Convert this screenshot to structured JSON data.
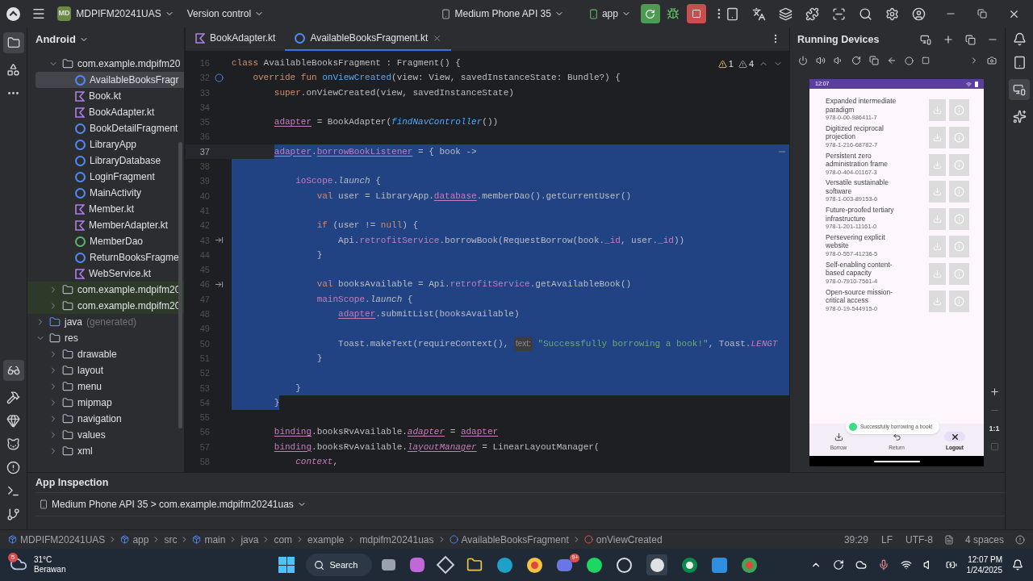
{
  "title_bar": {
    "project_badge": "MD",
    "project": "MDPIFM20241UAS",
    "vcs": "Version control",
    "device": "Medium Phone API 35",
    "run_config": "app"
  },
  "project_panel": {
    "view": "Android",
    "tree": [
      {
        "label": "com.example.mdpifm20",
        "kind": "package",
        "expanded": true,
        "selected": false,
        "children": [
          {
            "label": "AvailableBooksFragr",
            "kind": "class",
            "selected": true
          },
          {
            "label": "Book.kt",
            "kind": "kotlin_file",
            "selected": false
          },
          {
            "label": "BookAdapter.kt",
            "kind": "kotlin_file",
            "selected": false
          },
          {
            "label": "BookDetailFragment",
            "kind": "class",
            "selected": false
          },
          {
            "label": "LibraryApp",
            "kind": "class",
            "selected": false
          },
          {
            "label": "LibraryDatabase",
            "kind": "class",
            "selected": false
          },
          {
            "label": "LoginFragment",
            "kind": "class",
            "selected": false
          },
          {
            "label": "MainActivity",
            "kind": "class",
            "selected": false
          },
          {
            "label": "Member.kt",
            "kind": "kotlin_file",
            "selected": false
          },
          {
            "label": "MemberAdapter.kt",
            "kind": "kotlin_file",
            "selected": false
          },
          {
            "label": "MemberDao",
            "kind": "interface",
            "selected": false
          },
          {
            "label": "ReturnBooksFragme",
            "kind": "class",
            "selected": false
          },
          {
            "label": "WebService.kt",
            "kind": "kotlin_file",
            "selected": false
          }
        ]
      },
      {
        "label": "com.example.mdpifm20",
        "kind": "test_package",
        "expanded": false,
        "selected": false
      },
      {
        "label": "com.example.mdpifm20",
        "kind": "test_package",
        "expanded": false,
        "selected": false
      },
      {
        "label": "java",
        "note": "(generated)",
        "kind": "generated_folder",
        "expanded": false,
        "selected": false
      },
      {
        "label": "res",
        "kind": "res_folder",
        "expanded": true,
        "selected": false,
        "children": [
          {
            "label": "drawable",
            "kind": "folder",
            "expanded": false,
            "selected": false
          },
          {
            "label": "layout",
            "kind": "folder",
            "expanded": false,
            "selected": false
          },
          {
            "label": "menu",
            "kind": "folder",
            "expanded": false,
            "selected": false
          },
          {
            "label": "mipmap",
            "kind": "folder",
            "expanded": false,
            "selected": false
          },
          {
            "label": "navigation",
            "kind": "folder",
            "expanded": false,
            "selected": false
          },
          {
            "label": "values",
            "kind": "folder",
            "expanded": false,
            "selected": false
          },
          {
            "label": "xml",
            "kind": "folder",
            "expanded": false,
            "selected": false
          }
        ]
      }
    ]
  },
  "editor": {
    "tabs": [
      {
        "label": "BookAdapter.kt",
        "kind": "kotlin_file",
        "selected": false
      },
      {
        "label": "AvailableBooksFragment.kt",
        "kind": "class",
        "selected": true
      }
    ],
    "warnings": "1",
    "weak_warnings": "4",
    "lines": [
      {
        "number": "16",
        "current": false,
        "selected": false,
        "tokens": [
          {
            "text": "class",
            "kind": "kw"
          },
          {
            "text": " AvailableBooksFragment : Fragment() {",
            "kind": "plain"
          }
        ]
      },
      {
        "number": "32",
        "current": false,
        "selected": false,
        "gutter": {
          "kind": "override"
        },
        "tokens": [
          {
            "text": "    override fun",
            "kind": "kw"
          },
          {
            "text": " onViewCreated",
            "kind": "decl"
          },
          {
            "text": "(view: View, savedInstanceState: Bundle?) {",
            "kind": "plain"
          }
        ]
      },
      {
        "number": "33",
        "current": false,
        "selected": false,
        "tokens": [
          {
            "text": "        super",
            "kind": "kw"
          },
          {
            "text": ".onViewCreated(view, savedInstanceState)",
            "kind": "plain"
          }
        ]
      },
      {
        "number": "34",
        "current": false,
        "selected": false
      },
      {
        "number": "35",
        "current": false,
        "selected": false,
        "tokens": [
          {
            "text": "        adapter",
            "kind": "var"
          },
          {
            "text": " = BookAdapter(",
            "kind": "plain"
          },
          {
            "text": "findNavController",
            "kind": "ext"
          },
          {
            "text": "())",
            "kind": "plain"
          }
        ]
      },
      {
        "number": "36",
        "current": false,
        "selected": false
      },
      {
        "number": "37",
        "current": true,
        "selected": true,
        "fold": true,
        "tokens": [
          {
            "text": "        adapter",
            "kind": "var"
          },
          {
            "text": ".",
            "kind": "plain"
          },
          {
            "text": "borrowBookListener",
            "kind": "var"
          },
          {
            "text": " = { book ->",
            "kind": "plain"
          }
        ]
      },
      {
        "number": "38",
        "current": false,
        "selected": true
      },
      {
        "number": "39",
        "current": false,
        "selected": true,
        "tokens": [
          {
            "text": "            ioScope",
            "kind": "prop"
          },
          {
            "text": ".",
            "kind": "plain"
          },
          {
            "text": "launch",
            "kind": "italic"
          },
          {
            "text": " {",
            "kind": "plain"
          }
        ]
      },
      {
        "number": "40",
        "current": false,
        "selected": true,
        "tokens": [
          {
            "text": "                val",
            "kind": "kw"
          },
          {
            "text": " user = LibraryApp.",
            "kind": "plain"
          },
          {
            "text": "database",
            "kind": "var"
          },
          {
            "text": ".memberDao().getCurrentUser()",
            "kind": "plain"
          }
        ]
      },
      {
        "number": "41",
        "current": false,
        "selected": true
      },
      {
        "number": "42",
        "current": false,
        "selected": true,
        "tokens": [
          {
            "text": "                if",
            "kind": "kw"
          },
          {
            "text": " (user != ",
            "kind": "plain"
          },
          {
            "text": "null",
            "kind": "kw"
          },
          {
            "text": ") {",
            "kind": "plain"
          }
        ]
      },
      {
        "number": "43",
        "current": false,
        "selected": true,
        "gutter": {
          "kind": "suspend"
        },
        "tokens": [
          {
            "text": "                    Api.",
            "kind": "plain"
          },
          {
            "text": "retrofitService",
            "kind": "prop"
          },
          {
            "text": ".borrowBook(RequestBorrow(book.",
            "kind": "plain"
          },
          {
            "text": "_id",
            "kind": "prop"
          },
          {
            "text": ", user.",
            "kind": "plain"
          },
          {
            "text": "_id",
            "kind": "prop"
          },
          {
            "text": "))",
            "kind": "plain"
          }
        ]
      },
      {
        "number": "44",
        "current": false,
        "selected": true,
        "tokens": [
          {
            "text": "                }",
            "kind": "plain"
          }
        ]
      },
      {
        "number": "45",
        "current": false,
        "selected": true
      },
      {
        "number": "46",
        "current": false,
        "selected": true,
        "gutter": {
          "kind": "suspend"
        },
        "tokens": [
          {
            "text": "                val",
            "kind": "kw"
          },
          {
            "text": " booksAvailable = Api.",
            "kind": "plain"
          },
          {
            "text": "retrofitService",
            "kind": "prop"
          },
          {
            "text": ".getAvailableBook()",
            "kind": "plain"
          }
        ]
      },
      {
        "number": "47",
        "current": false,
        "selected": true,
        "tokens": [
          {
            "text": "                mainScope",
            "kind": "prop"
          },
          {
            "text": ".",
            "kind": "plain"
          },
          {
            "text": "launch",
            "kind": "italic"
          },
          {
            "text": " {",
            "kind": "plain"
          }
        ]
      },
      {
        "number": "48",
        "current": false,
        "selected": true,
        "tokens": [
          {
            "text": "                    adapter",
            "kind": "var"
          },
          {
            "text": ".submitList(booksAvailable)",
            "kind": "plain"
          }
        ]
      },
      {
        "number": "49",
        "current": false,
        "selected": true
      },
      {
        "number": "50",
        "current": false,
        "selected": true,
        "tokens": [
          {
            "text": "                    Toast.makeText(requireContext(), ",
            "kind": "plain"
          },
          {
            "text": "text:",
            "kind": "hint"
          },
          {
            "text": " \"Successfully borrowing a book!\"",
            "kind": "string"
          },
          {
            "text": ", Toast.",
            "kind": "plain"
          },
          {
            "text": "LENGT",
            "kind": "const"
          }
        ]
      },
      {
        "number": "51",
        "current": false,
        "selected": true,
        "tokens": [
          {
            "text": "                }",
            "kind": "plain"
          }
        ]
      },
      {
        "number": "52",
        "current": false,
        "selected": true
      },
      {
        "number": "53",
        "current": false,
        "selected": true,
        "tokens": [
          {
            "text": "            }",
            "kind": "plain"
          }
        ]
      },
      {
        "number": "54",
        "current": false,
        "selected": true,
        "tokens": [
          {
            "text": "        }",
            "kind": "plain"
          }
        ]
      },
      {
        "number": "55",
        "current": false,
        "selected": false
      },
      {
        "number": "56",
        "current": false,
        "selected": false,
        "tokens": [
          {
            "text": "        binding",
            "kind": "var"
          },
          {
            "text": ".booksRvAvailable.",
            "kind": "plain"
          },
          {
            "text": "adapter",
            "kind": "ivar"
          },
          {
            "text": " = ",
            "kind": "plain"
          },
          {
            "text": "adapter",
            "kind": "var"
          }
        ]
      },
      {
        "number": "57",
        "current": false,
        "selected": false,
        "tokens": [
          {
            "text": "        binding",
            "kind": "var"
          },
          {
            "text": ".booksRvAvailable.",
            "kind": "plain"
          },
          {
            "text": "layoutManager",
            "kind": "ivar"
          },
          {
            "text": " = LinearLayoutManager(",
            "kind": "plain"
          }
        ]
      },
      {
        "number": "58",
        "current": false,
        "selected": false,
        "tokens": [
          {
            "text": "            context",
            "kind": "const"
          },
          {
            "text": ",",
            "kind": "plain"
          }
        ]
      }
    ]
  },
  "running_devices": {
    "title": "Running Devices",
    "phone": {
      "time": "12:07",
      "books": [
        {
          "title": "Expanded intermediate paradigm",
          "isbn": "978-0-00-986411-7"
        },
        {
          "title": "Digitized reciprocal projection",
          "isbn": "978-1-216-68782-7"
        },
        {
          "title": "Persistent zero administration frame",
          "isbn": "978-0-404-01167-3"
        },
        {
          "title": "Versatile sustainable software",
          "isbn": "978-1-003-89153-6"
        },
        {
          "title": "Future-proofed tertiary infrastructure",
          "isbn": "978-1-201-11161-0"
        },
        {
          "title": "Persevering explicit website",
          "isbn": "978-0-557-41236-5"
        },
        {
          "title": "Self-enabling content-based capacity",
          "isbn": "978-0-7910-7561-4"
        },
        {
          "title": "Open-source mission-critical access",
          "isbn": "978-0-19-544915-0"
        }
      ],
      "nav": [
        {
          "label": "Borrow",
          "kind": "borrow",
          "selected": false
        },
        {
          "label": "Return",
          "kind": "return",
          "selected": false
        },
        {
          "label": "Logout",
          "kind": "logout",
          "selected": true
        }
      ],
      "toast": "Successfully borrowing a book!"
    },
    "zoom_label": "1:1"
  },
  "app_inspection": {
    "title": "App Inspection",
    "target": "Medium Phone API 35 > com.example.mdpifm20241uas"
  },
  "status_bar": {
    "breadcrumbs": [
      {
        "label": "MDPIFM20241UAS",
        "kind": "module"
      },
      {
        "label": "app",
        "kind": "module"
      },
      {
        "label": "src",
        "kind": "plain"
      },
      {
        "label": "main",
        "kind": "module"
      },
      {
        "label": "java",
        "kind": "plain"
      },
      {
        "label": "com",
        "kind": "plain"
      },
      {
        "label": "example",
        "kind": "plain"
      },
      {
        "label": "mdpifm20241uas",
        "kind": "plain"
      },
      {
        "label": "AvailableBooksFragment",
        "kind": "class"
      },
      {
        "label": "onViewCreated",
        "kind": "method"
      }
    ],
    "position": "39:29",
    "line_separator": "LF",
    "encoding": "UTF-8",
    "indent": "4 spaces"
  },
  "taskbar": {
    "weather_badge": "5",
    "temperature": "31°C",
    "weather": "Berawan",
    "search": "Search",
    "chat_badge": "9+",
    "time": "12:07 PM",
    "date": "1/24/2025"
  }
}
